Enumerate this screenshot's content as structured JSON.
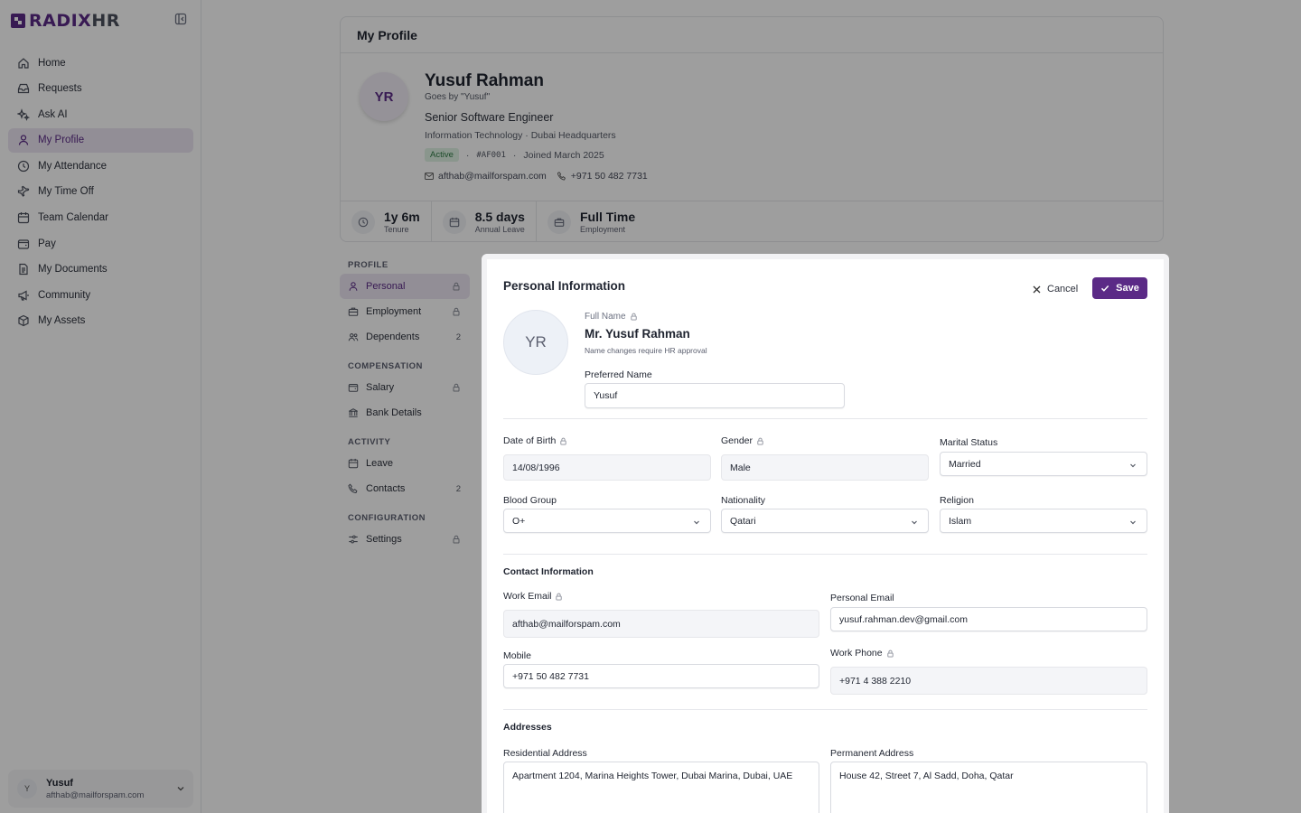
{
  "brand": {
    "name_part1": "RADIX",
    "name_part2": "HR",
    "color": "#5b2a86"
  },
  "sidebar": {
    "items": [
      {
        "label": "Home",
        "icon": "home-icon"
      },
      {
        "label": "Requests",
        "icon": "inbox-icon"
      },
      {
        "label": "Ask AI",
        "icon": "sparkles-icon"
      },
      {
        "label": "My Profile",
        "icon": "user-icon",
        "active": true
      },
      {
        "label": "My Attendance",
        "icon": "clock-icon"
      },
      {
        "label": "My Time Off",
        "icon": "plane-icon"
      },
      {
        "label": "Team Calendar",
        "icon": "calendar-icon"
      },
      {
        "label": "Pay",
        "icon": "wallet-icon"
      },
      {
        "label": "My Documents",
        "icon": "document-icon"
      },
      {
        "label": "Community",
        "icon": "megaphone-icon"
      },
      {
        "label": "My Assets",
        "icon": "box-icon"
      }
    ],
    "user": {
      "initial": "Y",
      "name": "Yusuf",
      "email": "afthab@mailforspam.com"
    }
  },
  "profile": {
    "header": "My Profile",
    "initials": "YR",
    "name": "Yusuf Rahman",
    "goes_by": "Goes by \"Yusuf\"",
    "title": "Senior Software Engineer",
    "dept_location": "Information Technology · Dubai Headquarters",
    "status": "Active",
    "employee_id": "#AF001",
    "joined": "Joined March 2025",
    "email": "afthab@mailforspam.com",
    "phone": "+971 50 482 7731",
    "stats": [
      {
        "value": "1y 6m",
        "label": "Tenure",
        "icon": "clock-icon"
      },
      {
        "value": "8.5 days",
        "label": "Annual Leave",
        "icon": "calendar-icon"
      },
      {
        "value": "Full Time",
        "label": "Employment",
        "icon": "briefcase-icon"
      }
    ]
  },
  "subnav": {
    "sections": [
      {
        "title": "PROFILE",
        "items": [
          {
            "label": "Personal",
            "icon": "user-icon",
            "right": "lock",
            "active": true
          },
          {
            "label": "Employment",
            "icon": "briefcase-icon",
            "right": "lock"
          },
          {
            "label": "Dependents",
            "icon": "users-icon",
            "right": "2"
          }
        ]
      },
      {
        "title": "COMPENSATION",
        "items": [
          {
            "label": "Salary",
            "icon": "wallet-icon",
            "right": "lock"
          },
          {
            "label": "Bank Details",
            "icon": "bank-icon",
            "right": ""
          }
        ]
      },
      {
        "title": "ACTIVITY",
        "items": [
          {
            "label": "Leave",
            "icon": "calendar-icon",
            "right": ""
          },
          {
            "label": "Contacts",
            "icon": "phone-icon",
            "right": "2"
          }
        ]
      },
      {
        "title": "CONFIGURATION",
        "items": [
          {
            "label": "Settings",
            "icon": "sliders-icon",
            "right": "lock"
          }
        ]
      }
    ]
  },
  "modal": {
    "title": "Personal Information",
    "cancel_label": "Cancel",
    "save_label": "Save",
    "avatar_initials": "YR",
    "full_name_label": "Full Name",
    "full_name_value": "Mr. Yusuf Rahman",
    "full_name_note": "Name changes require HR approval",
    "preferred_name_label": "Preferred Name",
    "preferred_name_value": "Yusuf",
    "dob_label": "Date of Birth",
    "dob_value": "14/08/1996",
    "gender_label": "Gender",
    "gender_value": "Male",
    "marital_label": "Marital Status",
    "marital_value": "Married",
    "blood_label": "Blood Group",
    "blood_value": "O+",
    "nationality_label": "Nationality",
    "nationality_value": "Qatari",
    "religion_label": "Religion",
    "religion_value": "Islam",
    "contact_title": "Contact Information",
    "work_email_label": "Work Email",
    "work_email_value": "afthab@mailforspam.com",
    "personal_email_label": "Personal Email",
    "personal_email_value": "yusuf.rahman.dev@gmail.com",
    "mobile_label": "Mobile",
    "mobile_value": "+971 50 482 7731",
    "work_phone_label": "Work Phone",
    "work_phone_value": "+971 4 388 2210",
    "addresses_title": "Addresses",
    "residential_label": "Residential Address",
    "residential_value": "Apartment 1204, Marina Heights Tower, Dubai Marina, Dubai, UAE",
    "permanent_label": "Permanent Address",
    "permanent_value": "House 42, Street 7, Al Sadd, Doha, Qatar"
  }
}
